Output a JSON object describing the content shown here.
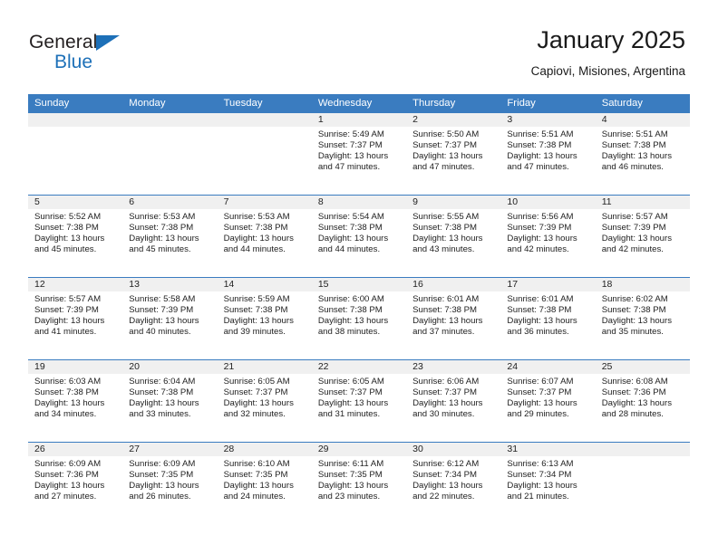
{
  "brand": {
    "line1": "General",
    "line2": "Blue",
    "triangle_color": "#1d70b8"
  },
  "header": {
    "title": "January 2025",
    "location": "Capiovi, Misiones, Argentina"
  },
  "theme": {
    "header_blue": "#3a7cc0",
    "daynum_band": "#f0f0f0",
    "text": "#222222"
  },
  "weekday_headers": [
    "Sunday",
    "Monday",
    "Tuesday",
    "Wednesday",
    "Thursday",
    "Friday",
    "Saturday"
  ],
  "weeks": [
    [
      {
        "day": "",
        "sunrise": "",
        "sunset": "",
        "daylight1": "",
        "daylight2": "",
        "empty": true
      },
      {
        "day": "",
        "sunrise": "",
        "sunset": "",
        "daylight1": "",
        "daylight2": "",
        "empty": true
      },
      {
        "day": "",
        "sunrise": "",
        "sunset": "",
        "daylight1": "",
        "daylight2": "",
        "empty": true
      },
      {
        "day": "1",
        "sunrise": "Sunrise: 5:49 AM",
        "sunset": "Sunset: 7:37 PM",
        "daylight1": "Daylight: 13 hours",
        "daylight2": "and 47 minutes."
      },
      {
        "day": "2",
        "sunrise": "Sunrise: 5:50 AM",
        "sunset": "Sunset: 7:37 PM",
        "daylight1": "Daylight: 13 hours",
        "daylight2": "and 47 minutes."
      },
      {
        "day": "3",
        "sunrise": "Sunrise: 5:51 AM",
        "sunset": "Sunset: 7:38 PM",
        "daylight1": "Daylight: 13 hours",
        "daylight2": "and 47 minutes."
      },
      {
        "day": "4",
        "sunrise": "Sunrise: 5:51 AM",
        "sunset": "Sunset: 7:38 PM",
        "daylight1": "Daylight: 13 hours",
        "daylight2": "and 46 minutes."
      }
    ],
    [
      {
        "day": "5",
        "sunrise": "Sunrise: 5:52 AM",
        "sunset": "Sunset: 7:38 PM",
        "daylight1": "Daylight: 13 hours",
        "daylight2": "and 45 minutes."
      },
      {
        "day": "6",
        "sunrise": "Sunrise: 5:53 AM",
        "sunset": "Sunset: 7:38 PM",
        "daylight1": "Daylight: 13 hours",
        "daylight2": "and 45 minutes."
      },
      {
        "day": "7",
        "sunrise": "Sunrise: 5:53 AM",
        "sunset": "Sunset: 7:38 PM",
        "daylight1": "Daylight: 13 hours",
        "daylight2": "and 44 minutes."
      },
      {
        "day": "8",
        "sunrise": "Sunrise: 5:54 AM",
        "sunset": "Sunset: 7:38 PM",
        "daylight1": "Daylight: 13 hours",
        "daylight2": "and 44 minutes."
      },
      {
        "day": "9",
        "sunrise": "Sunrise: 5:55 AM",
        "sunset": "Sunset: 7:38 PM",
        "daylight1": "Daylight: 13 hours",
        "daylight2": "and 43 minutes."
      },
      {
        "day": "10",
        "sunrise": "Sunrise: 5:56 AM",
        "sunset": "Sunset: 7:39 PM",
        "daylight1": "Daylight: 13 hours",
        "daylight2": "and 42 minutes."
      },
      {
        "day": "11",
        "sunrise": "Sunrise: 5:57 AM",
        "sunset": "Sunset: 7:39 PM",
        "daylight1": "Daylight: 13 hours",
        "daylight2": "and 42 minutes."
      }
    ],
    [
      {
        "day": "12",
        "sunrise": "Sunrise: 5:57 AM",
        "sunset": "Sunset: 7:39 PM",
        "daylight1": "Daylight: 13 hours",
        "daylight2": "and 41 minutes."
      },
      {
        "day": "13",
        "sunrise": "Sunrise: 5:58 AM",
        "sunset": "Sunset: 7:39 PM",
        "daylight1": "Daylight: 13 hours",
        "daylight2": "and 40 minutes."
      },
      {
        "day": "14",
        "sunrise": "Sunrise: 5:59 AM",
        "sunset": "Sunset: 7:38 PM",
        "daylight1": "Daylight: 13 hours",
        "daylight2": "and 39 minutes."
      },
      {
        "day": "15",
        "sunrise": "Sunrise: 6:00 AM",
        "sunset": "Sunset: 7:38 PM",
        "daylight1": "Daylight: 13 hours",
        "daylight2": "and 38 minutes."
      },
      {
        "day": "16",
        "sunrise": "Sunrise: 6:01 AM",
        "sunset": "Sunset: 7:38 PM",
        "daylight1": "Daylight: 13 hours",
        "daylight2": "and 37 minutes."
      },
      {
        "day": "17",
        "sunrise": "Sunrise: 6:01 AM",
        "sunset": "Sunset: 7:38 PM",
        "daylight1": "Daylight: 13 hours",
        "daylight2": "and 36 minutes."
      },
      {
        "day": "18",
        "sunrise": "Sunrise: 6:02 AM",
        "sunset": "Sunset: 7:38 PM",
        "daylight1": "Daylight: 13 hours",
        "daylight2": "and 35 minutes."
      }
    ],
    [
      {
        "day": "19",
        "sunrise": "Sunrise: 6:03 AM",
        "sunset": "Sunset: 7:38 PM",
        "daylight1": "Daylight: 13 hours",
        "daylight2": "and 34 minutes."
      },
      {
        "day": "20",
        "sunrise": "Sunrise: 6:04 AM",
        "sunset": "Sunset: 7:38 PM",
        "daylight1": "Daylight: 13 hours",
        "daylight2": "and 33 minutes."
      },
      {
        "day": "21",
        "sunrise": "Sunrise: 6:05 AM",
        "sunset": "Sunset: 7:37 PM",
        "daylight1": "Daylight: 13 hours",
        "daylight2": "and 32 minutes."
      },
      {
        "day": "22",
        "sunrise": "Sunrise: 6:05 AM",
        "sunset": "Sunset: 7:37 PM",
        "daylight1": "Daylight: 13 hours",
        "daylight2": "and 31 minutes."
      },
      {
        "day": "23",
        "sunrise": "Sunrise: 6:06 AM",
        "sunset": "Sunset: 7:37 PM",
        "daylight1": "Daylight: 13 hours",
        "daylight2": "and 30 minutes."
      },
      {
        "day": "24",
        "sunrise": "Sunrise: 6:07 AM",
        "sunset": "Sunset: 7:37 PM",
        "daylight1": "Daylight: 13 hours",
        "daylight2": "and 29 minutes."
      },
      {
        "day": "25",
        "sunrise": "Sunrise: 6:08 AM",
        "sunset": "Sunset: 7:36 PM",
        "daylight1": "Daylight: 13 hours",
        "daylight2": "and 28 minutes."
      }
    ],
    [
      {
        "day": "26",
        "sunrise": "Sunrise: 6:09 AM",
        "sunset": "Sunset: 7:36 PM",
        "daylight1": "Daylight: 13 hours",
        "daylight2": "and 27 minutes."
      },
      {
        "day": "27",
        "sunrise": "Sunrise: 6:09 AM",
        "sunset": "Sunset: 7:35 PM",
        "daylight1": "Daylight: 13 hours",
        "daylight2": "and 26 minutes."
      },
      {
        "day": "28",
        "sunrise": "Sunrise: 6:10 AM",
        "sunset": "Sunset: 7:35 PM",
        "daylight1": "Daylight: 13 hours",
        "daylight2": "and 24 minutes."
      },
      {
        "day": "29",
        "sunrise": "Sunrise: 6:11 AM",
        "sunset": "Sunset: 7:35 PM",
        "daylight1": "Daylight: 13 hours",
        "daylight2": "and 23 minutes."
      },
      {
        "day": "30",
        "sunrise": "Sunrise: 6:12 AM",
        "sunset": "Sunset: 7:34 PM",
        "daylight1": "Daylight: 13 hours",
        "daylight2": "and 22 minutes."
      },
      {
        "day": "31",
        "sunrise": "Sunrise: 6:13 AM",
        "sunset": "Sunset: 7:34 PM",
        "daylight1": "Daylight: 13 hours",
        "daylight2": "and 21 minutes."
      },
      {
        "day": "",
        "sunrise": "",
        "sunset": "",
        "daylight1": "",
        "daylight2": "",
        "empty": true
      }
    ]
  ]
}
